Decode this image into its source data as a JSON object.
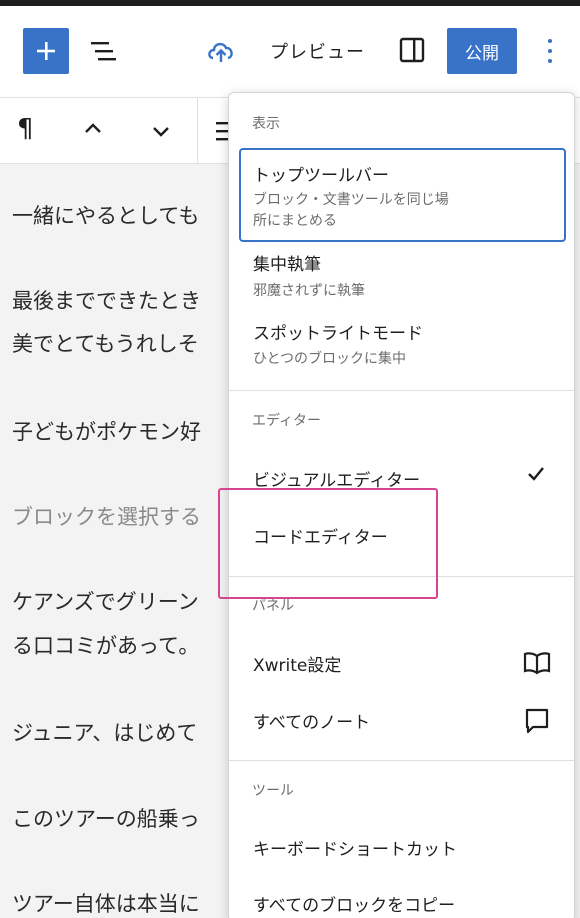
{
  "header": {
    "preview_label": "プレビュー",
    "publish_label": "公開"
  },
  "content": {
    "paragraphs": [
      "一緒にやるとしても",
      "最後までできたとき",
      "美でとてもうれしそ",
      "子どもがポケモン好",
      "ブロックを選択する",
      "ケアンズでグリーン",
      "る口コミがあって。",
      "ジュニア、はじめて",
      "このツアーの船乗っ",
      "ツアー自体は本当に"
    ]
  },
  "menu": {
    "view_group_label": "表示",
    "top_toolbar": {
      "title": "トップツールバー",
      "desc_line1": "ブロック・文書ツールを同じ場",
      "desc_line2": "所にまとめる"
    },
    "distraction_free": {
      "title": "集中執筆",
      "desc": "邪魔されずに執筆"
    },
    "spotlight": {
      "title": "スポットライトモード",
      "desc": "ひとつのブロックに集中"
    },
    "editor_group_label": "エディター",
    "visual_editor": "ビジュアルエディター",
    "code_editor": "コードエディター",
    "panels_group_label": "パネル",
    "xwrite_settings": "Xwrite設定",
    "all_notes": "すべてのノート",
    "tools_group_label": "ツール",
    "keyboard_shortcuts": "キーボードショートカット",
    "copy_all_blocks": "すべてのブロックをコピー"
  },
  "icons": {
    "add": "plus-icon",
    "document_overview": "list-view-icon",
    "save": "cloud-upload-icon",
    "sidebar": "sidebar-toggle-icon",
    "options": "vertical-ellipsis-icon",
    "paragraph": "pilcrow-icon",
    "move_up": "chevron-up-icon",
    "move_down": "chevron-down-icon",
    "check": "checkmark-icon",
    "xwrite": "book-icon",
    "notes": "comment-icon"
  },
  "colors": {
    "accent": "#3873c8",
    "highlight": "#d64592"
  }
}
